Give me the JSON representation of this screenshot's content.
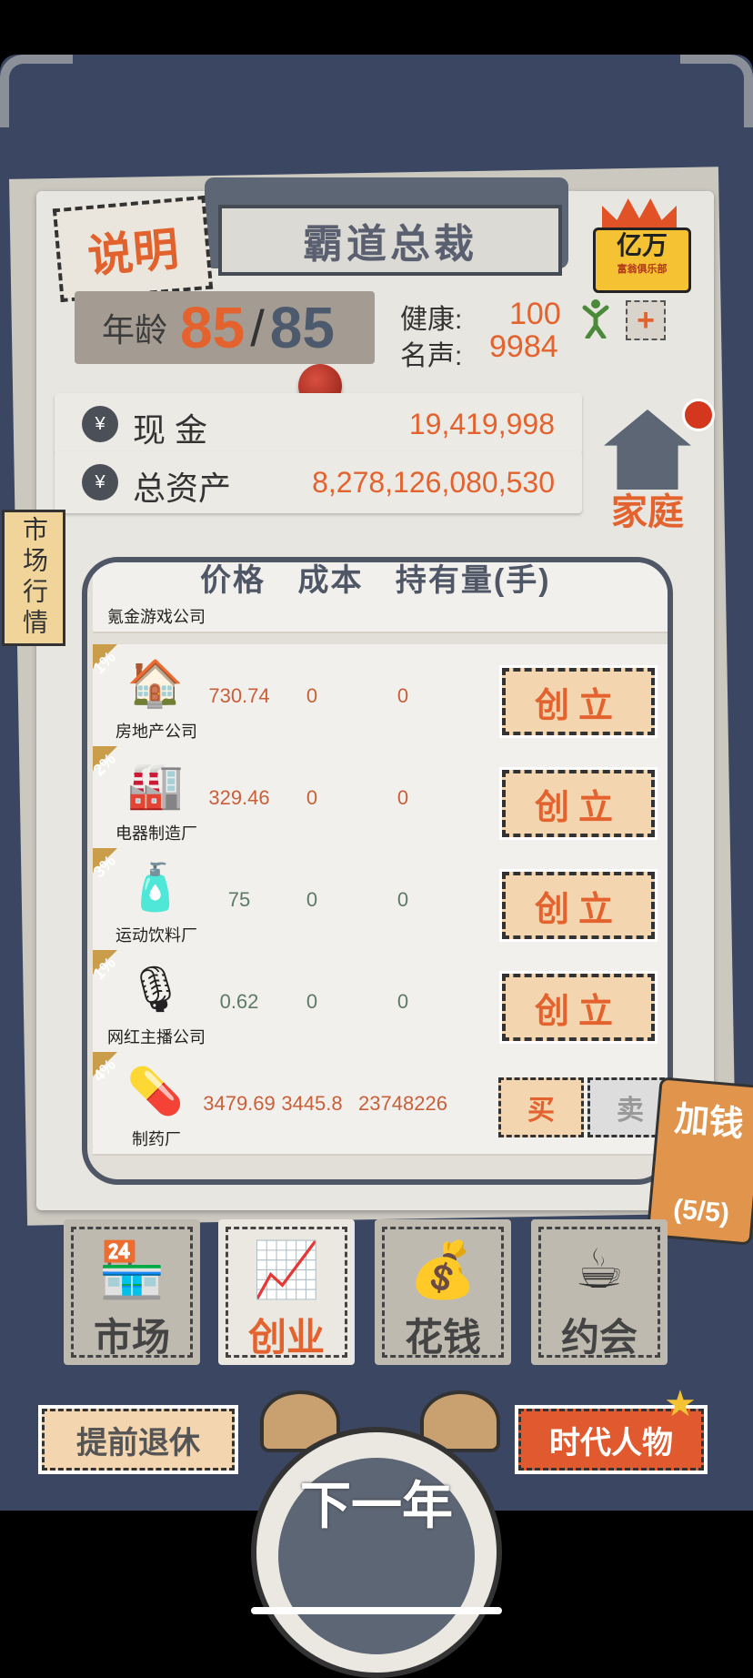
{
  "title": "霸道总裁",
  "explain_label": "说明",
  "club": {
    "big": "亿万",
    "small": "富翁俱乐部"
  },
  "age": {
    "label": "年龄",
    "current": "85",
    "sep": "/",
    "max": "85"
  },
  "stats": {
    "health_label": "健康:",
    "health_value": "100",
    "fame_label": "名声:",
    "fame_value": "9984",
    "plus": "+"
  },
  "cash": {
    "label": "现 金",
    "value": "19,419,998"
  },
  "assets": {
    "label": "总资产",
    "value": "8,278,126,080,530"
  },
  "home_label": "家庭",
  "market_tab": "市场行情",
  "table_headers": [
    "价格",
    "成本",
    "持有量(手)"
  ],
  "rows": [
    {
      "name": "房地产公司",
      "pct": "1%",
      "price": "730.74",
      "cost": "0",
      "qty": "0",
      "action": "创立",
      "price_color": "#c8603a"
    },
    {
      "name": "电器制造厂",
      "pct": "2%",
      "price": "329.46",
      "cost": "0",
      "qty": "0",
      "action": "创立",
      "price_color": "#c8603a"
    },
    {
      "name": "运动饮料厂",
      "pct": "3%",
      "price": "75",
      "cost": "0",
      "qty": "0",
      "action": "创立",
      "price_color": "#5d7a66"
    },
    {
      "name": "网红主播公司",
      "pct": "1%",
      "price": "0.62",
      "cost": "0",
      "qty": "0",
      "action": "创立",
      "price_color": "#5d7a66"
    },
    {
      "name": "制药厂",
      "pct": "4%",
      "price": "3479.69",
      "cost": "3445.8",
      "qty": "23748226",
      "buy": "买",
      "sell": "卖",
      "price_color": "#c8603a"
    }
  ],
  "partial_row_name": "氪金游戏公司",
  "add_money": {
    "label": "加钱",
    "count": "(5/5)"
  },
  "nav": [
    {
      "label": "市场",
      "icon": "shop-icon"
    },
    {
      "label": "创业",
      "icon": "chart-icon"
    },
    {
      "label": "花钱",
      "icon": "spend-icon"
    },
    {
      "label": "约会",
      "icon": "coffee-icon"
    }
  ],
  "retire_label": "提前退休",
  "era_label": "时代人物",
  "next_year_label": "下一年",
  "colors": {
    "accent": "#e3622d",
    "frame": "#3b4762",
    "paper": "#e8e6e1"
  }
}
